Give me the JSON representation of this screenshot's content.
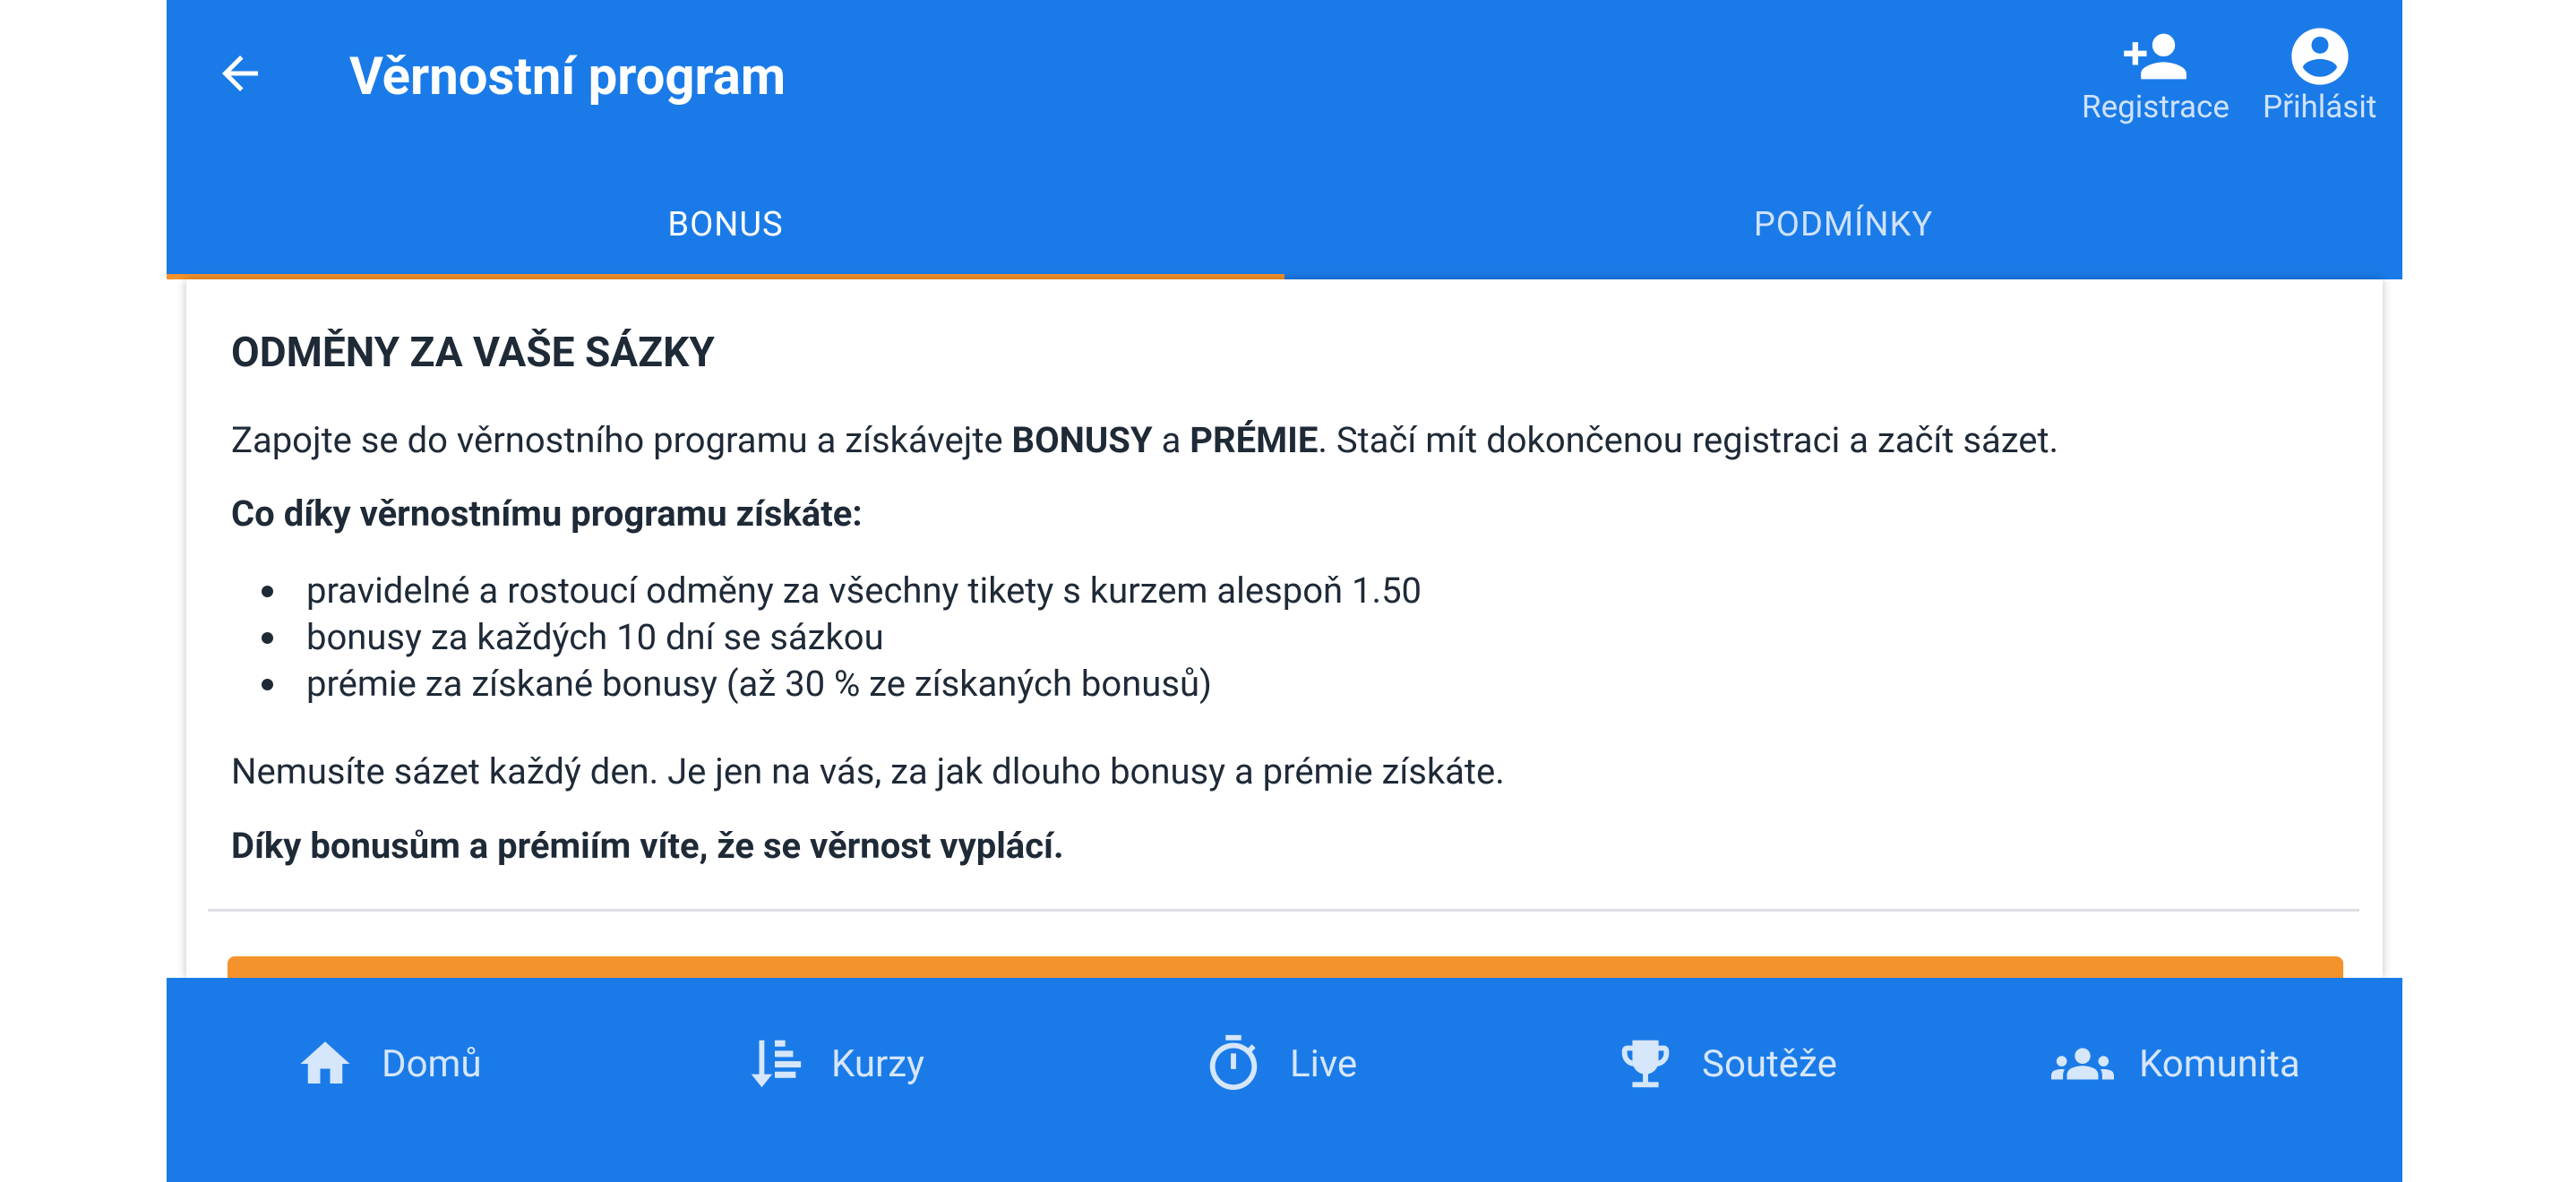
{
  "header": {
    "title": "Věrnostní program",
    "actions": [
      {
        "label": "Registrace",
        "icon": "person-add-icon"
      },
      {
        "label": "Přihlásit",
        "icon": "account-circle-icon"
      }
    ]
  },
  "tabs": [
    {
      "label": "BONUS",
      "active": true
    },
    {
      "label": "PODMÍNKY",
      "active": false
    }
  ],
  "content": {
    "title": "ODMĚNY ZA VAŠE SÁZKY",
    "intro": {
      "pre": "Zapojte se do věrnostního programu a získávejte ",
      "bold1": "BONUSY",
      "mid": " a ",
      "bold2": "PRÉMIE",
      "post": ". Stačí mít dokončenou registraci a začít sázet."
    },
    "benefits_heading": "Co díky věrnostnímu programu získáte:",
    "benefits": [
      "pravidelné a rostoucí odměny za všechny tikety s kurzem alespoň 1.50",
      "bonusy za každých 10 dní se sázkou",
      "prémie za získané bonusy (až 30 % ze získaných bonusů)"
    ],
    "note": "Nemusíte sázet každý den. Je jen na vás, za jak dlouho bonusy a prémie získáte.",
    "closing": "Díky bonusům a prémiím víte, že se věrnost vyplácí."
  },
  "bottom_nav": [
    {
      "label": "Domů",
      "icon": "home-icon"
    },
    {
      "label": "Kurzy",
      "icon": "odds-list-icon"
    },
    {
      "label": "Live",
      "icon": "stopwatch-icon"
    },
    {
      "label": "Soutěže",
      "icon": "trophy-icon"
    },
    {
      "label": "Komunita",
      "icon": "community-icon"
    }
  ],
  "colors": {
    "primary": "#1a7be8",
    "accent": "#f4922b",
    "text": "#1f2a37"
  }
}
